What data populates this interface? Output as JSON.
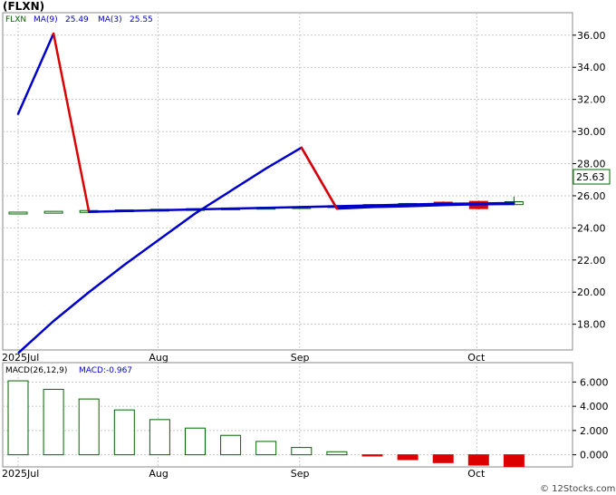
{
  "title": "(FLXN)",
  "footer": "© 12Stocks.com",
  "price_panel": {
    "legend": {
      "ticker": "FLXN",
      "ma9_label": "MA(9)",
      "ma9_value": "25.49",
      "ma3_label": "MA(3)",
      "ma3_value": "25.55"
    },
    "last_price": "25.63",
    "colors": {
      "ma9": "#0000cc",
      "ma3": "#0000cc",
      "ma3_down": "#dd0000",
      "candle_up": "#006600",
      "candle_down": "#dd0000"
    }
  },
  "macd_panel": {
    "label": "MACD(26,12,9)",
    "value_label": "MACD:-0.967"
  },
  "chart_data": [
    {
      "type": "line",
      "name": "price",
      "x_tick_labels": [
        "2025Jul",
        "Aug",
        "Sep",
        "Oct"
      ],
      "x_tick_positions": [
        0,
        4,
        8,
        13
      ],
      "ylim": [
        16.4,
        37.4
      ],
      "y_ticks": [
        "18.00",
        "20.00",
        "22.00",
        "24.00",
        "26.00",
        "28.00",
        "30.00",
        "32.00",
        "34.00",
        "36.00"
      ],
      "candles": [
        {
          "x": 0,
          "o": 24.92,
          "c": 24.98,
          "h": 25.0,
          "l": 24.9,
          "dir": "up"
        },
        {
          "x": 1,
          "o": 24.98,
          "c": 25.03,
          "h": 25.05,
          "l": 24.95,
          "dir": "up"
        },
        {
          "x": 2,
          "o": 25.02,
          "c": 25.08,
          "h": 25.1,
          "l": 25.0,
          "dir": "up"
        },
        {
          "x": 3,
          "o": 25.06,
          "c": 25.12,
          "h": 25.14,
          "l": 25.04,
          "dir": "up"
        },
        {
          "x": 4,
          "o": 25.1,
          "c": 25.16,
          "h": 25.18,
          "l": 25.08,
          "dir": "up"
        },
        {
          "x": 5,
          "o": 25.14,
          "c": 25.2,
          "h": 25.22,
          "l": 25.12,
          "dir": "up"
        },
        {
          "x": 6,
          "o": 25.18,
          "c": 25.24,
          "h": 25.26,
          "l": 25.16,
          "dir": "up"
        },
        {
          "x": 7,
          "o": 25.22,
          "c": 25.28,
          "h": 25.3,
          "l": 25.2,
          "dir": "up"
        },
        {
          "x": 8,
          "o": 25.25,
          "c": 25.32,
          "h": 25.34,
          "l": 25.22,
          "dir": "up"
        },
        {
          "x": 9,
          "o": 25.28,
          "c": 25.38,
          "h": 25.4,
          "l": 25.25,
          "dir": "up"
        },
        {
          "x": 10,
          "o": 25.33,
          "c": 25.45,
          "h": 25.48,
          "l": 25.3,
          "dir": "up"
        },
        {
          "x": 11,
          "o": 25.42,
          "c": 25.52,
          "h": 25.55,
          "l": 25.38,
          "dir": "up"
        },
        {
          "x": 12,
          "o": 25.6,
          "c": 25.45,
          "h": 25.65,
          "l": 25.4,
          "dir": "down"
        },
        {
          "x": 13,
          "o": 25.65,
          "c": 25.2,
          "h": 25.7,
          "l": 25.15,
          "dir": "down"
        },
        {
          "x": 14,
          "o": 25.45,
          "c": 25.63,
          "h": 25.95,
          "l": 25.4,
          "dir": "up"
        }
      ],
      "series": [
        {
          "name": "MA(9)",
          "x": [
            0,
            1,
            2,
            3,
            4,
            5,
            6,
            7,
            8,
            9,
            10,
            11,
            12,
            13,
            14
          ],
          "values": [
            16.2,
            18.2,
            20.0,
            21.7,
            23.3,
            24.9,
            26.3,
            27.7,
            29.0,
            25.2,
            25.3,
            25.35,
            25.42,
            25.47,
            25.49
          ]
        },
        {
          "name": "MA(3)",
          "x": [
            0,
            1,
            2,
            3,
            4,
            5,
            6,
            7,
            8,
            9,
            10,
            11,
            12,
            13,
            14
          ],
          "values": [
            31.1,
            36.1,
            25.0,
            25.05,
            25.1,
            25.15,
            25.2,
            25.25,
            25.3,
            25.35,
            25.4,
            25.45,
            25.5,
            25.52,
            25.55
          ]
        }
      ]
    },
    {
      "type": "bar",
      "name": "MACD",
      "ylim": [
        -1.0,
        7.6
      ],
      "y_ticks": [
        "0.000",
        "2.000",
        "4.000",
        "6.000"
      ],
      "x_tick_labels": [
        "2025Jul",
        "Aug",
        "Sep",
        "Oct"
      ],
      "x": [
        0,
        1,
        2,
        3,
        4,
        5,
        6,
        7,
        8,
        9,
        10,
        11,
        12,
        13,
        14
      ],
      "values": [
        6.1,
        5.4,
        4.6,
        3.7,
        2.9,
        2.2,
        1.6,
        1.1,
        0.6,
        0.25,
        -0.1,
        -0.4,
        -0.65,
        -0.85,
        -0.967
      ]
    }
  ]
}
